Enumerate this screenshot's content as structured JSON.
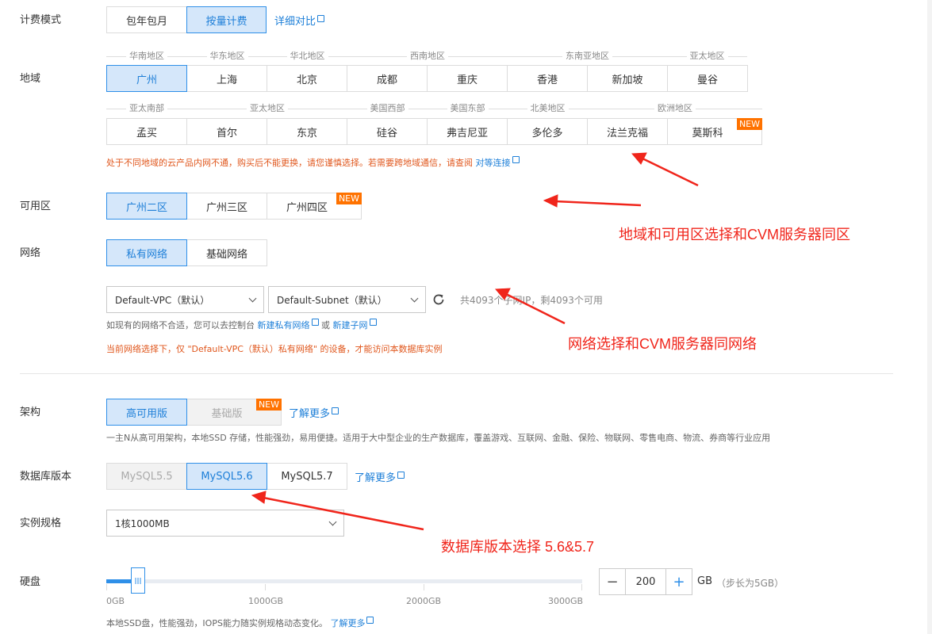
{
  "billing": {
    "label": "计费模式",
    "options": [
      "包年包月",
      "按量计费"
    ],
    "selected": 1,
    "compare_link": "详细对比"
  },
  "region": {
    "label": "地域",
    "row1_groups": [
      "华南地区",
      "华东地区",
      "华北地区",
      "西南地区",
      "东南亚地区",
      "亚太地区"
    ],
    "row1": [
      "广州",
      "上海",
      "北京",
      "成都",
      "重庆",
      "香港",
      "新加坡",
      "曼谷"
    ],
    "row2_groups": [
      "亚太南部",
      "亚太地区",
      "美国西部",
      "美国东部",
      "北美地区",
      "欧洲地区"
    ],
    "row2": [
      "孟买",
      "首尔",
      "东京",
      "硅谷",
      "弗吉尼亚",
      "多伦多",
      "法兰克福",
      "莫斯科"
    ],
    "new_badge": "NEW",
    "warning": "处于不同地域的云产品内网不通，购买后不能更换，请您谨慎选择。若需要跨地域通信，请查阅",
    "warning_link": "对等连接"
  },
  "zone": {
    "label": "可用区",
    "options": [
      "广州二区",
      "广州三区",
      "广州四区"
    ],
    "selected": 0,
    "new_badge": "NEW"
  },
  "network": {
    "label": "网络",
    "options": [
      "私有网络",
      "基础网络"
    ],
    "selected": 0,
    "vpc": "Default-VPC（默认）",
    "subnet": "Default-Subnet（默认）",
    "ip_info": "共4093个子网IP，剩4093个可用",
    "hint_prefix": "如现有的网络不合适，您可以去控制台",
    "hint_link1": "新建私有网络",
    "hint_or": "或",
    "hint_link2": "新建子网",
    "warning": "当前网络选择下，仅 \"Default-VPC（默认）私有网络\" 的设备，才能访问本数据库实例"
  },
  "arch": {
    "label": "架构",
    "options": [
      "高可用版",
      "基础版"
    ],
    "selected": 0,
    "new_badge": "NEW",
    "learn_more": "了解更多",
    "desc": "一主N从高可用架构，本地SSD 存储，性能强劲，易用便捷。适用于大中型企业的生产数据库，覆盖游戏、互联网、金融、保险、物联网、零售电商、物流、券商等行业应用"
  },
  "db_version": {
    "label": "数据库版本",
    "options": [
      "MySQL5.5",
      "MySQL5.6",
      "MySQL5.7"
    ],
    "selected": 1,
    "learn_more": "了解更多"
  },
  "spec": {
    "label": "实例规格",
    "value": "1核1000MB"
  },
  "disk": {
    "label": "硬盘",
    "ticks": [
      "0GB",
      "1000GB",
      "2000GB",
      "3000GB"
    ],
    "value": "200",
    "unit": "GB",
    "step_note": "（步长为5GB）",
    "fill_fraction": 0.0667,
    "minus": "−",
    "plus": "+",
    "hint": "本地SSD盘，性能强劲，IOPS能力随实例规格动态变化。",
    "learn_more": "了解更多"
  },
  "annotations": {
    "a1": "地域和可用区选择和CVM服务器同区",
    "a2": "网络选择和CVM服务器同网络",
    "a3": "数据库版本选择 5.6&5.7"
  },
  "colors": {
    "accent": "#2e8fe8",
    "selected_bg": "#d5e7fa",
    "badge": "#ff7200",
    "warn": "#e0571d",
    "annotation": "#f0251b"
  }
}
